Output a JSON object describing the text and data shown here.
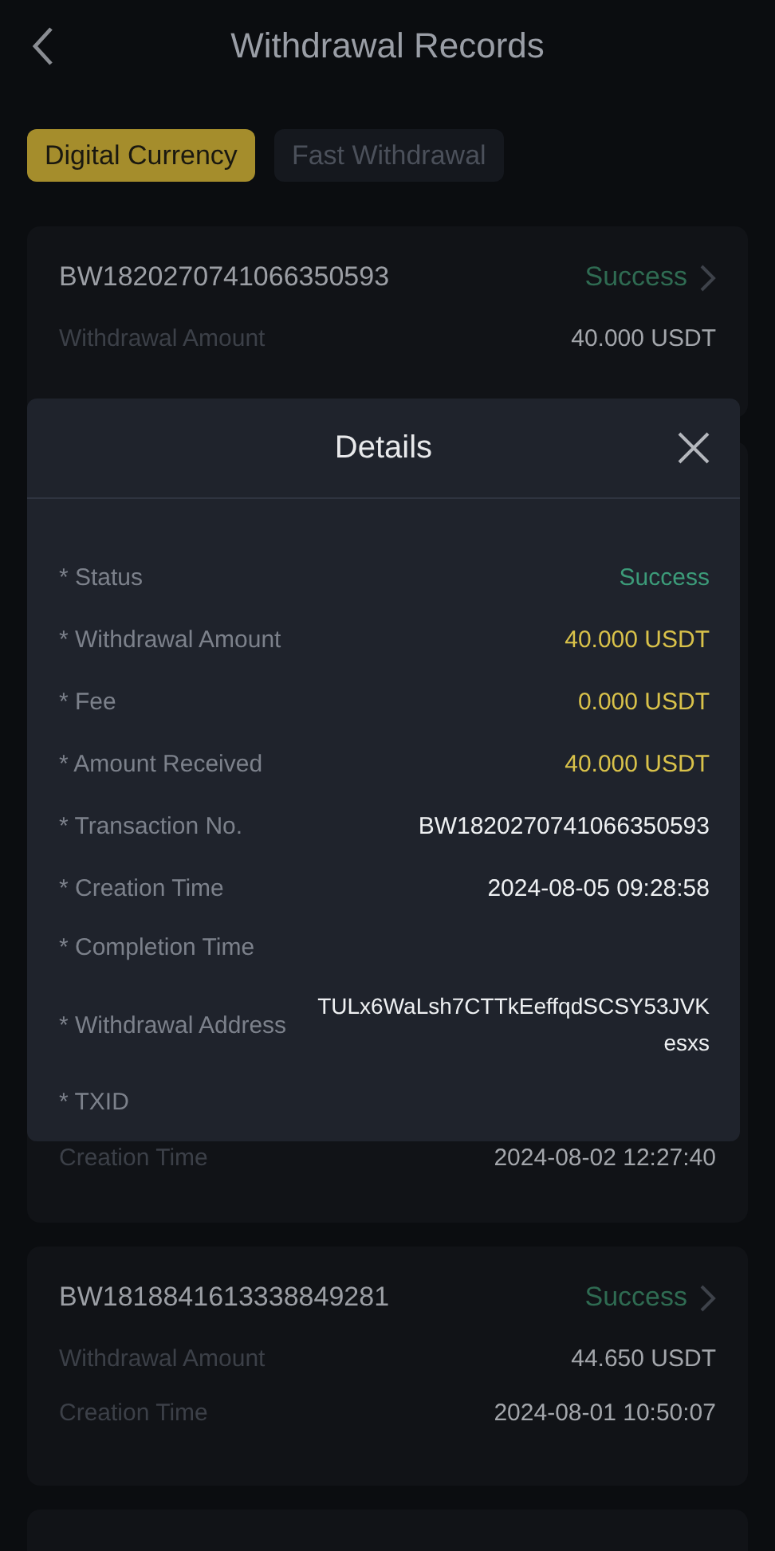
{
  "header": {
    "title": "Withdrawal Records"
  },
  "tabs": [
    {
      "label": "Digital Currency",
      "selected": true
    },
    {
      "label": "Fast Withdrawal",
      "selected": false
    }
  ],
  "records": [
    {
      "number": "BW1820270741066350593",
      "status": "Success",
      "rows": [
        {
          "label": "Withdrawal Amount",
          "value": "40.000 USDT"
        }
      ]
    },
    {
      "rows": [
        {
          "label": "Creation Time",
          "value": "2024-08-02 12:27:40"
        }
      ]
    },
    {
      "number": "BW1818841613338849281",
      "status": "Success",
      "rows": [
        {
          "label": "Withdrawal Amount",
          "value": "44.650 USDT"
        },
        {
          "label": "Creation Time",
          "value": "2024-08-01 10:50:07"
        }
      ]
    }
  ],
  "dialog": {
    "title": "Details",
    "fields": [
      {
        "label": "* Status",
        "value": "Success",
        "color": "#3c9b79"
      },
      {
        "label": "* Withdrawal Amount",
        "value": "40.000 USDT",
        "color": "#d9c24a"
      },
      {
        "label": "* Fee",
        "value": "0.000 USDT",
        "color": "#d9c24a"
      },
      {
        "label": "* Amount Received",
        "value": "40.000 USDT",
        "color": "#d9c24a"
      },
      {
        "label": "* Transaction No.",
        "value": "BW1820270741066350593",
        "color": "#eef0f2"
      },
      {
        "label": "* Creation Time",
        "value": "2024-08-05 09:28:58",
        "color": "#eef0f2"
      },
      {
        "label": "* Completion Time"
      },
      {
        "label": "* Withdrawal Address",
        "value": "TULx6WaLsh7CTTkEeffqdSCSY53JVKesxs",
        "color": "#eef0f2"
      },
      {
        "label": "* TXID"
      }
    ]
  }
}
